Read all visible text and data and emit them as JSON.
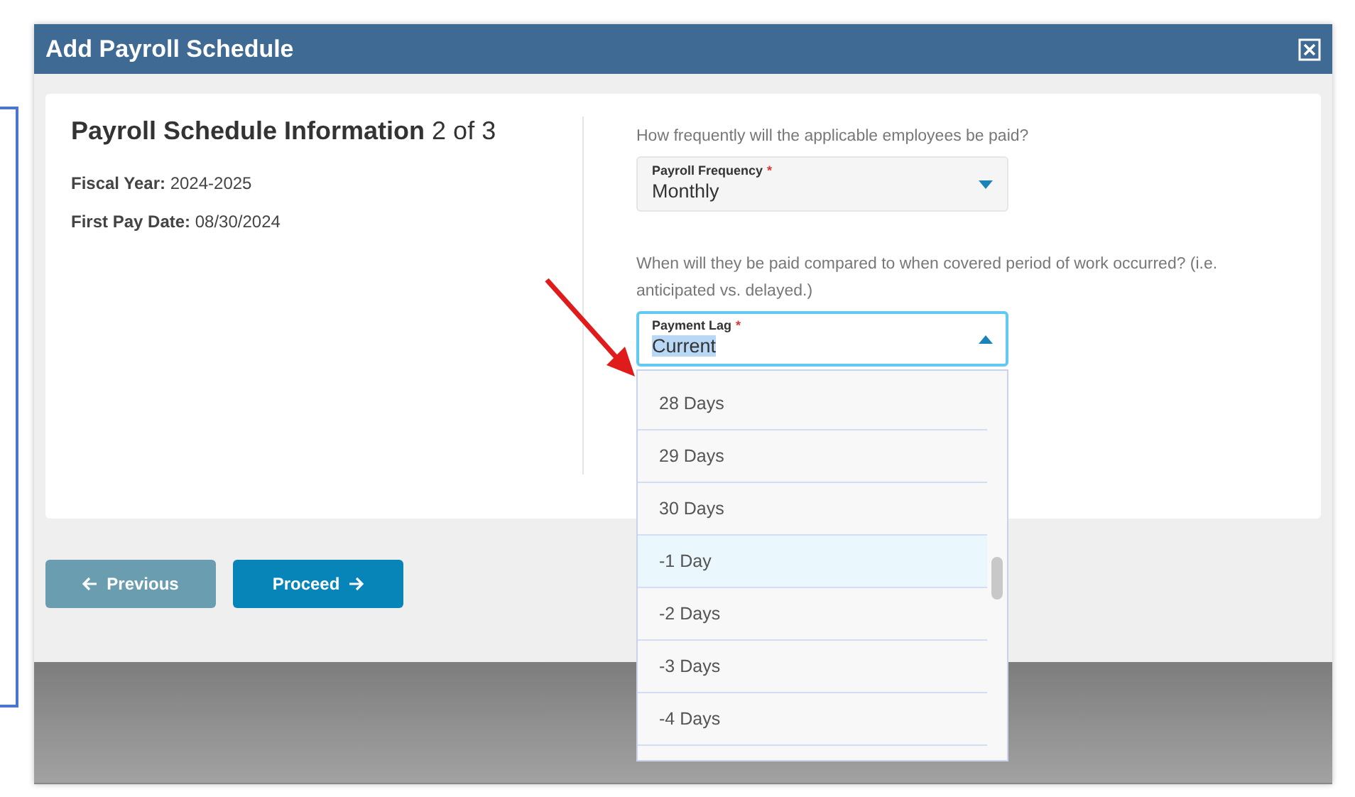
{
  "dialog": {
    "title": "Add Payroll Schedule"
  },
  "summary": {
    "heading": "**Payroll Schedule Information** 2 of 3",
    "facts": [
      "**Fiscal Year:** 2024-2025",
      "**First Pay Date:** 08/30/2024"
    ]
  },
  "fields": [
    {
      "question": "How frequently will the applicable employees be paid?",
      "label": "Payroll Frequency",
      "required_mark": "*",
      "value": "Monthly",
      "expanded": false
    },
    {
      "question": "When will they be paid compared to when covered period of work occurred? (i.e. anticipated vs. delayed.)",
      "label": "Payment Lag",
      "required_mark": "*",
      "value": "Current",
      "expanded": true,
      "options": [
        {
          "label": "28 Days",
          "selected": false
        },
        {
          "label": "29 Days",
          "selected": false
        },
        {
          "label": "30 Days",
          "selected": false
        },
        {
          "label": "-1 Day",
          "selected": true
        },
        {
          "label": "-2 Days",
          "selected": false
        },
        {
          "label": "-3 Days",
          "selected": false
        },
        {
          "label": "-4 Days",
          "selected": false
        }
      ]
    }
  ],
  "buttons": [
    {
      "label": "Previous",
      "kind": "back"
    },
    {
      "label": "Proceed",
      "kind": "forward"
    }
  ]
}
